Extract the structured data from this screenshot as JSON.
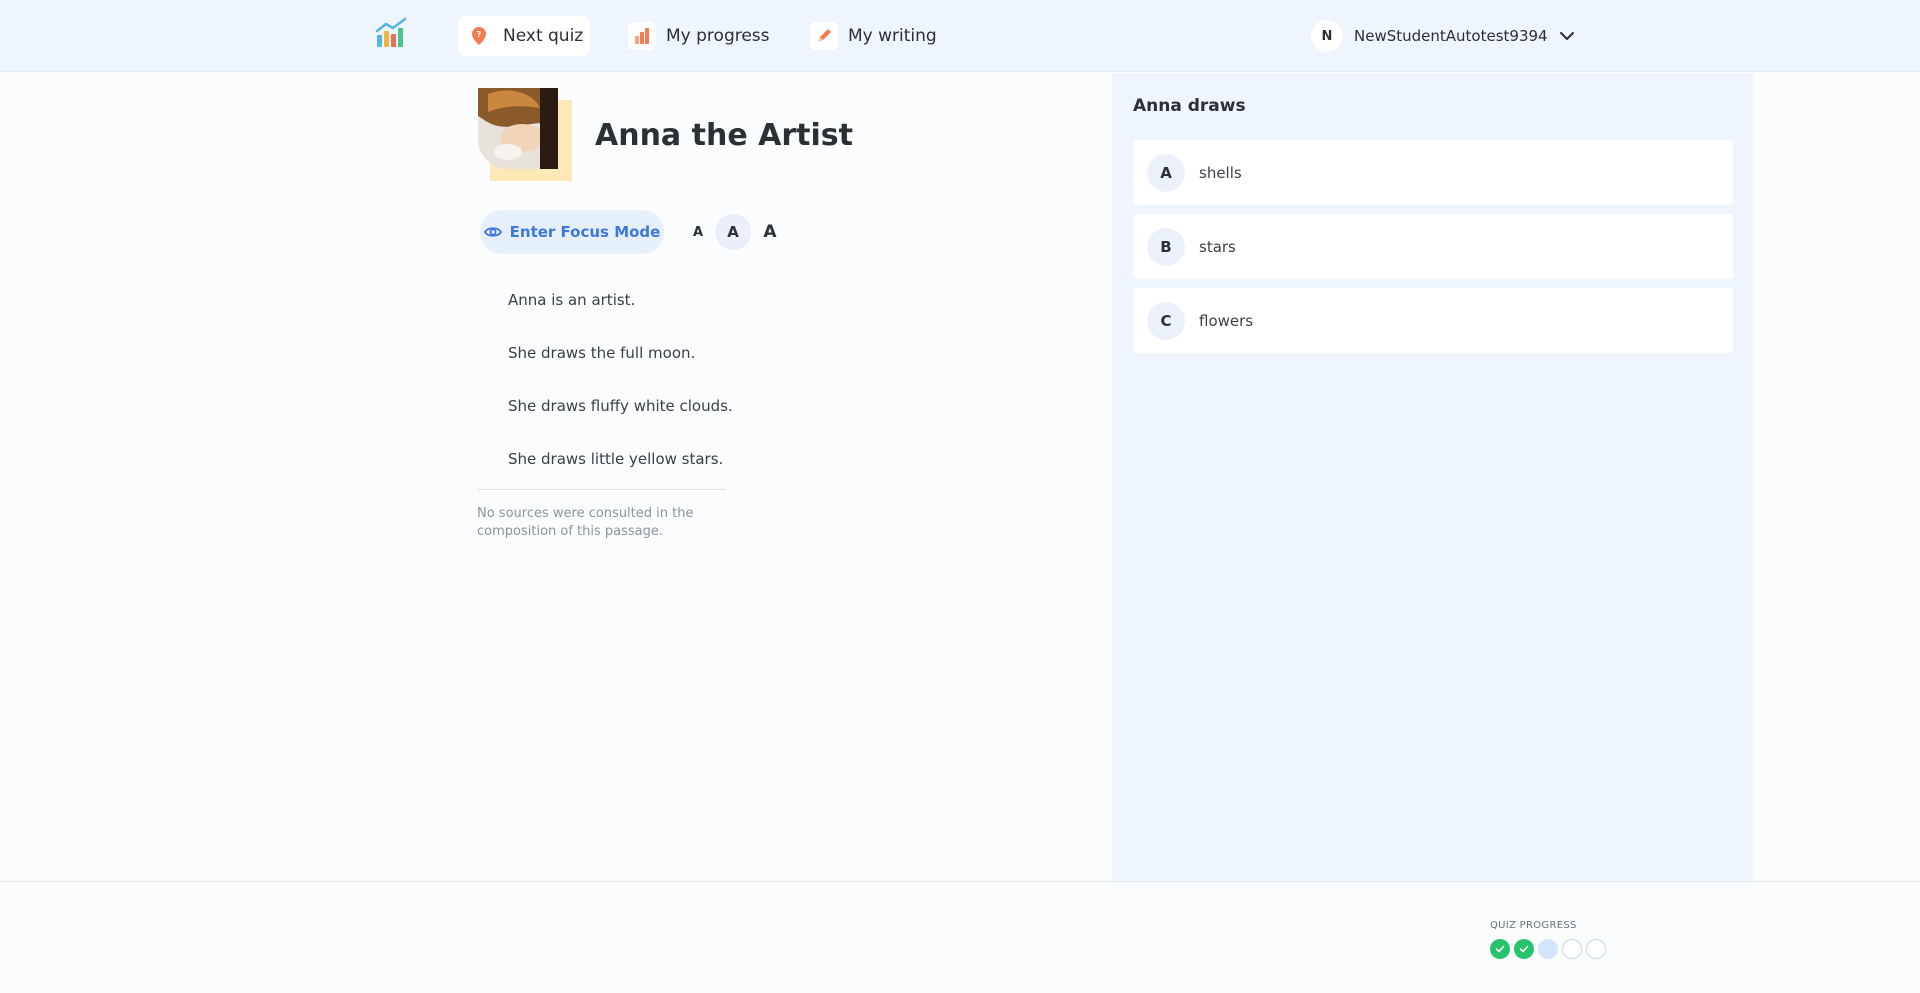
{
  "header": {
    "nav": [
      {
        "label": "Next quiz",
        "icon": "map-pin-icon",
        "active": true
      },
      {
        "label": "My progress",
        "icon": "bar-chart-icon",
        "active": false
      },
      {
        "label": "My writing",
        "icon": "pencil-icon",
        "active": false
      }
    ],
    "user": {
      "initial": "N",
      "name": "NewStudentAutotest9394"
    }
  },
  "passage": {
    "title": "Anna the Artist",
    "focus_label": "Enter Focus Mode",
    "font_sizes": [
      "A",
      "A",
      "A"
    ],
    "selected_font_size": "medium",
    "paragraphs": [
      "Anna is an artist.",
      "She draws the full moon.",
      "She draws fluffy white clouds.",
      "She draws little yellow stars."
    ],
    "sources_note": "No sources were consulted in the composition of this passage."
  },
  "question": {
    "title": "Anna draws",
    "options": [
      {
        "letter": "A",
        "text": "shells"
      },
      {
        "letter": "B",
        "text": "stars"
      },
      {
        "letter": "C",
        "text": "flowers"
      }
    ]
  },
  "footer": {
    "progress_label": "QUIZ PROGRESS",
    "progress": [
      "done",
      "done",
      "current",
      "todo",
      "todo"
    ]
  },
  "colors": {
    "accent": "#3f78d8",
    "nav_icon": "#f47b4f",
    "success": "#27c36a",
    "panel_bg": "#eef5fe"
  }
}
